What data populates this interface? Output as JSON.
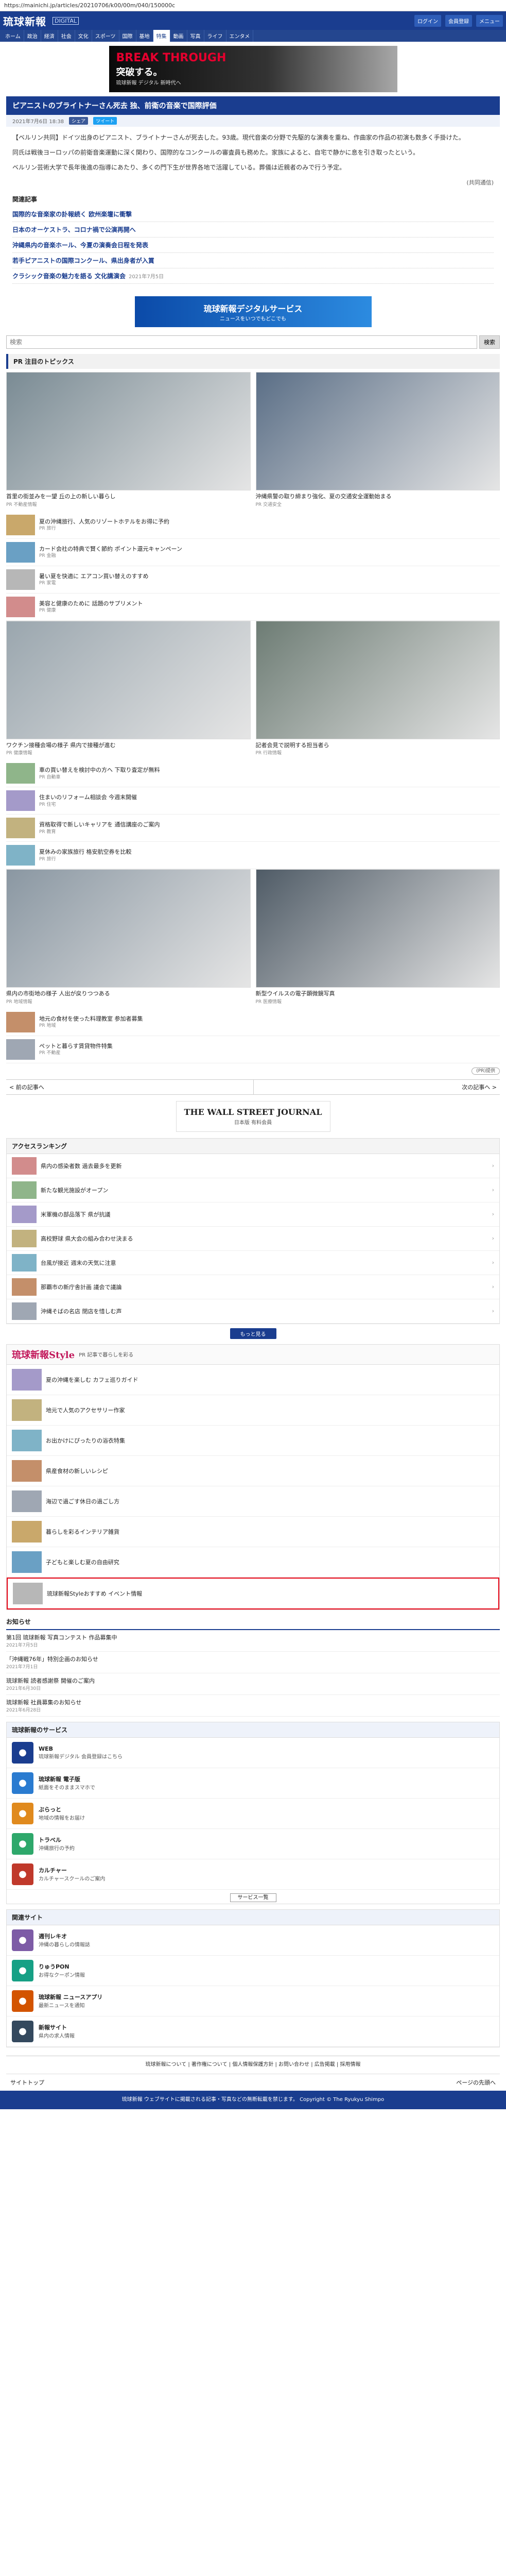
{
  "browser": {
    "url": "https://mainichi.jp/articles/20210706/k00/00m/040/150000c"
  },
  "header": {
    "logo": "琉球新報",
    "logo_sub": "DIGITAL",
    "login": "ログイン",
    "register": "会員登録",
    "menu": "メニュー"
  },
  "nav": [
    "ホーム",
    "政治",
    "経済",
    "社会",
    "文化",
    "スポーツ",
    "国際",
    "基地",
    "特集",
    "動画",
    "写真",
    "ライフ",
    "エンタメ"
  ],
  "nav_active": 8,
  "banner": {
    "line1": "BREAK THROUGH",
    "line2": "突破する。",
    "sub": "琉球新報 デジタル 新時代へ"
  },
  "article": {
    "title": "ピアニストのブライトナーさん死去 独、前衛の音楽で国際評価",
    "date": "2021年7月6日 18:38",
    "share_fb": "シェア",
    "share_tw": "ツイート",
    "paragraphs": [
      "【ベルリン共同】ドイツ出身のピアニスト、ブライトナーさんが死去した。93歳。現代音楽の分野で先駆的な演奏を重ね、作曲家の作品の初演も数多く手掛けた。",
      "同氏は戦後ヨーロッパの前衛音楽運動に深く関わり、国際的なコンクールの審査員も務めた。家族によると、自宅で静かに息を引き取ったという。",
      "ベルリン芸術大学で長年後進の指導にあたり、多くの門下生が世界各地で活躍している。葬儀は近親者のみで行う予定。"
    ],
    "credit": "(共同通信)"
  },
  "related": {
    "title": "関連記事",
    "items": [
      {
        "title": "国際的な音楽家の訃報続く 欧州楽壇に衝撃",
        "date": ""
      },
      {
        "title": "日本のオーケストラ、コロナ禍で公演再開へ",
        "date": ""
      },
      {
        "title": "沖縄県内の音楽ホール、今夏の演奏会日程を発表",
        "date": ""
      },
      {
        "title": "若手ピアニストの国際コンクール、県出身者が入賞",
        "date": ""
      },
      {
        "title": "クラシック音楽の魅力を語る 文化講演会",
        "date": "2021年7月5日"
      }
    ]
  },
  "app_banner": {
    "line1": "琉球新報デジタルサービス",
    "line2": "ニュースをいつでもどこでも"
  },
  "search": {
    "placeholder": "検索",
    "button": "検索"
  },
  "pr_section": {
    "title": "PR 注目のトピックス",
    "cards": [
      {
        "caption": "首里の街並みを一望 丘の上の新しい暮らし",
        "source": "PR 不動産情報"
      },
      {
        "caption": "沖縄県警の取り締まり強化、夏の交通安全運動始まる",
        "source": "PR 交通安全"
      },
      {
        "caption": "ワクチン接種会場の様子 県内で接種が進む",
        "source": "PR 健康情報"
      },
      {
        "caption": "記者会見で説明する担当者ら",
        "source": "PR 行政情報"
      },
      {
        "caption": "県内の市街地の様子 人出が戻りつつある",
        "source": "PR 地域情報"
      },
      {
        "caption": "新型ウイルスの電子顕微鏡写真",
        "source": "PR 医療情報"
      }
    ],
    "rows": [
      {
        "text": "夏の沖縄旅行、人気のリゾートホテルをお得に予約",
        "source": "PR 旅行"
      },
      {
        "text": "カード会社の特典で賢く節約 ポイント還元キャンペーン",
        "source": "PR 金融"
      },
      {
        "text": "暑い夏を快適に エアコン買い替えのすすめ",
        "source": "PR 家電"
      },
      {
        "text": "美容と健康のために 話題のサプリメント",
        "source": "PR 健康"
      },
      {
        "text": "車の買い替えを検討中の方へ 下取り査定が無料",
        "source": "PR 自動車"
      },
      {
        "text": "住まいのリフォーム相談会 今週末開催",
        "source": "PR 住宅"
      },
      {
        "text": "資格取得で新しいキャリアを 通信講座のご案内",
        "source": "PR 教育"
      },
      {
        "text": "夏休みの家族旅行 格安航空券を比較",
        "source": "PR 旅行"
      },
      {
        "text": "地元の食材を使った料理教室 参加者募集",
        "source": "PR 地域"
      },
      {
        "text": "ペットと暮らす賃貸物件特集",
        "source": "PR 不動産"
      }
    ],
    "credit": "(PR)提供"
  },
  "pager": {
    "prev": "< 前の記事へ",
    "next": "次の記事へ >"
  },
  "wsj": {
    "name": "THE WALL STREET JOURNAL",
    "tag": "日本版 有料会員"
  },
  "ranking": {
    "title": "アクセスランキング",
    "items": [
      "県内の感染者数 過去最多を更新",
      "新たな観光施設がオープン",
      "米軍機の部品落下 県が抗議",
      "高校野球 県大会の組み合わせ決まる",
      "台風が接近 週末の天気に注意",
      "那覇市の新庁舎計画 議会で議論",
      "沖縄そばの名店 閉店を惜しむ声"
    ],
    "more": "もっと見る"
  },
  "style": {
    "logo": "琉球新報Style",
    "tag": "PR 記事で暮らしを彩る",
    "items": [
      "夏の沖縄を楽しむ カフェ巡りガイド",
      "地元で人気のアクセサリー作家",
      "お出かけにぴったりの浴衣特集",
      "県産食材の新しいレシピ",
      "海辺で過ごす休日の過ごし方",
      "暮らしを彩るインテリア雑貨",
      "子どもと楽しむ夏の自由研究",
      "琉球新報Styleおすすめ イベント情報"
    ]
  },
  "news": {
    "title": "お知らせ",
    "items": [
      {
        "text": "第1回 琉球新報 写真コンテスト 作品募集中",
        "date": "2021年7月5日"
      },
      {
        "text": "「沖縄戦76年」特別企画のお知らせ",
        "date": "2021年7月1日"
      },
      {
        "text": "琉球新報 読者感謝祭 開催のご案内",
        "date": "2021年6月30日"
      },
      {
        "text": "琉球新報 社員募集のお知らせ",
        "date": "2021年6月28日"
      }
    ]
  },
  "services": {
    "title": "琉球新報のサービス",
    "items": [
      {
        "name": "WEB",
        "desc": "琉球新報デジタル 会員登録はこちら"
      },
      {
        "name": "琉球新報 電子版",
        "desc": "紙面をそのままスマホで"
      },
      {
        "name": "ぶらっと",
        "desc": "地域の情報をお届け"
      },
      {
        "name": "トラベル",
        "desc": "沖縄旅行の予約"
      },
      {
        "name": "カルチャー",
        "desc": "カルチャースクールのご案内"
      }
    ],
    "more": "サービス一覧"
  },
  "others": {
    "title": "関連サイト",
    "items": [
      {
        "name": "週刊レキオ",
        "desc": "沖縄の暮らしの情報誌"
      },
      {
        "name": "りゅうPON",
        "desc": "お得なクーポン情報"
      },
      {
        "name": "琉球新報 ニュースアプリ",
        "desc": "最新ニュースを通知"
      },
      {
        "name": "新報サイト",
        "desc": "県内の求人情報"
      }
    ]
  },
  "footer": {
    "links": "琉球新報について | 著作権について | 個人情報保護方針 | お問い合わせ | 広告掲載 | 採用情報",
    "top": "サイトトップ",
    "pagetop": "ページの先頭へ",
    "copy": "琉球新報 ウェブサイトに掲載される記事・写真などの無断転載を禁じます。 Copyright © The Ryukyu Shimpo"
  }
}
